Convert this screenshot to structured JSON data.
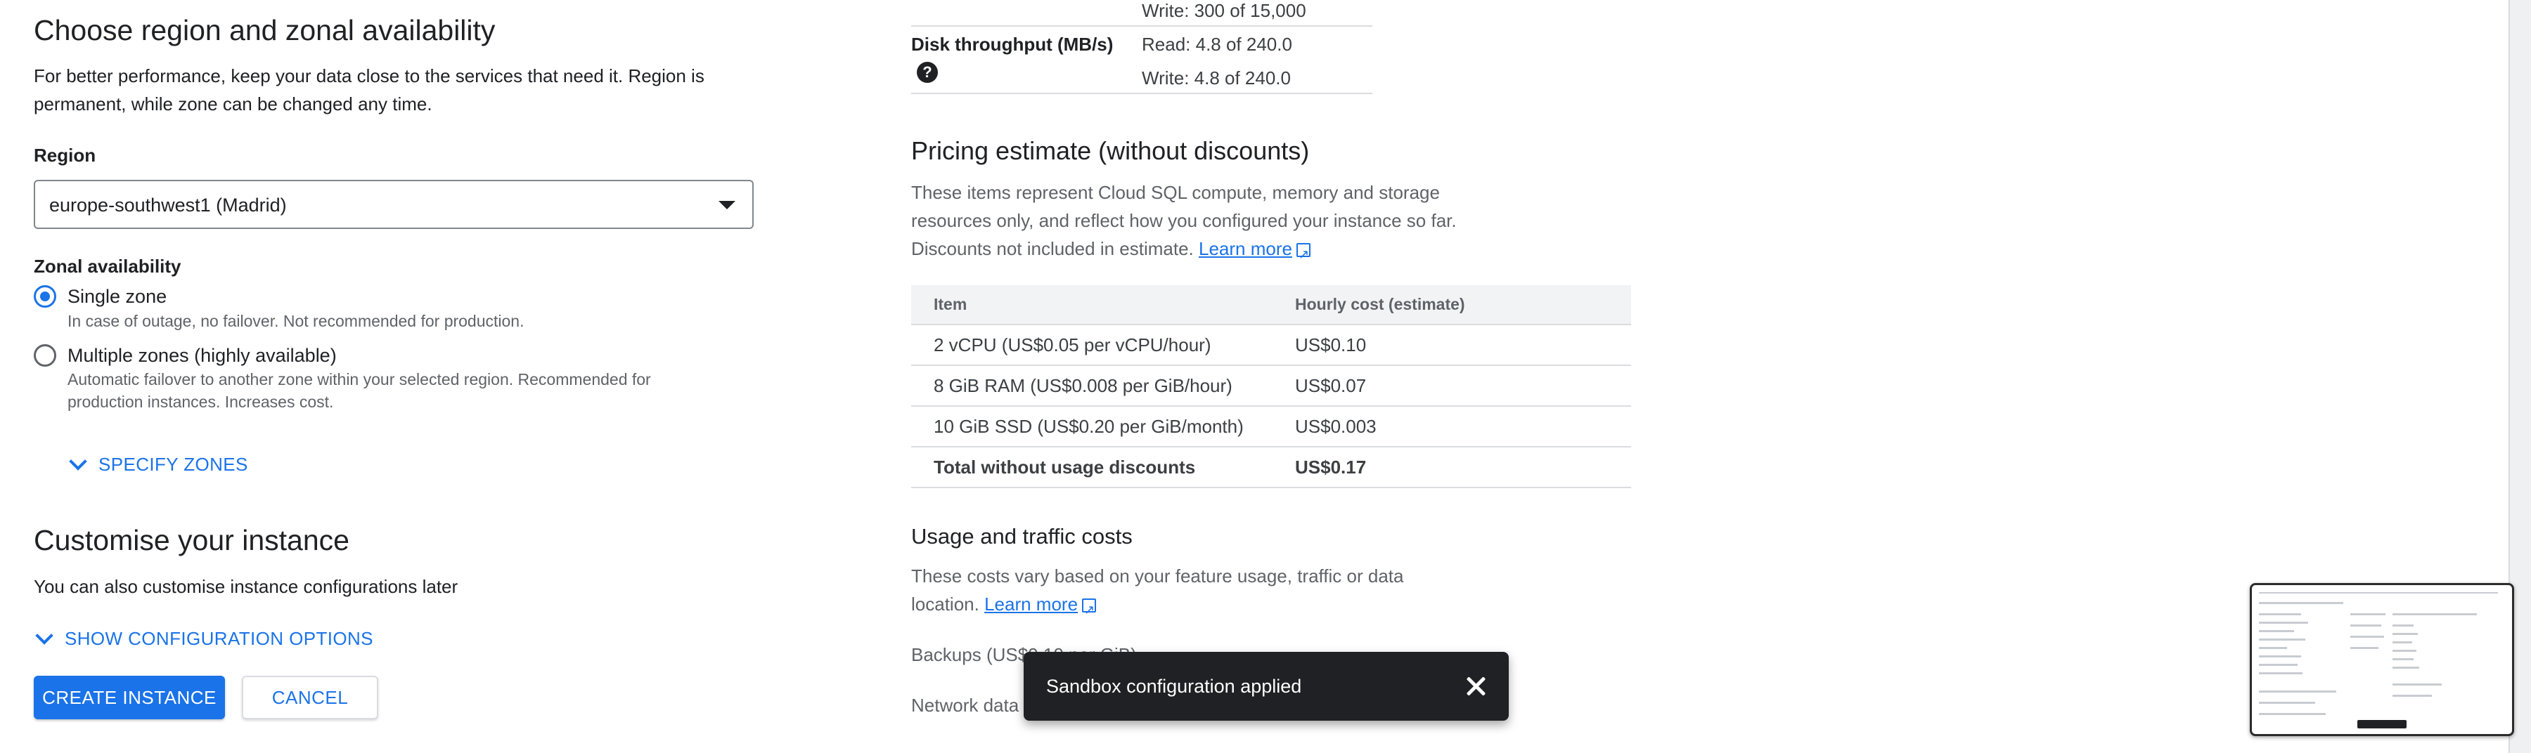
{
  "region_section": {
    "title": "Choose region and zonal availability",
    "description": "For better performance, keep your data close to the services that need it. Region is permanent, while zone can be changed any time.",
    "region_label": "Region",
    "region_value": "europe-southwest1 (Madrid)",
    "zonal_label": "Zonal availability",
    "options": [
      {
        "title": "Single zone",
        "help": "In case of outage, no failover. Not recommended for production.",
        "selected": true
      },
      {
        "title": "Multiple zones (highly available)",
        "help": "Automatic failover to another zone within your selected region. Recommended for production instances. Increases cost.",
        "selected": false
      }
    ],
    "specify_zones_label": "SPECIFY ZONES"
  },
  "customise_section": {
    "title": "Customise your instance",
    "description": "You can also customise instance configurations later",
    "show_options_label": "SHOW CONFIGURATION OPTIONS"
  },
  "actions": {
    "create_label": "CREATE INSTANCE",
    "cancel_label": "CANCEL"
  },
  "performance": {
    "iops_write": "Write: 300 of 15,000",
    "throughput_label": "Disk throughput (MB/s)",
    "throughput_read": "Read: 4.8 of 240.0",
    "throughput_write": "Write: 4.8 of 240.0",
    "help_icon": "help-circle-icon"
  },
  "pricing": {
    "title": "Pricing estimate (without discounts)",
    "description": "These items represent Cloud SQL compute, memory and storage resources only, and reflect how you configured your instance so far. Discounts not included in estimate.",
    "learn_more": "Learn more",
    "columns": [
      "Item",
      "Hourly cost (estimate)"
    ],
    "rows": [
      {
        "item": "2 vCPU (US$0.05 per vCPU/hour)",
        "cost": "US$0.10"
      },
      {
        "item": "8 GiB RAM (US$0.008 per GiB/hour)",
        "cost": "US$0.07"
      },
      {
        "item": "10 GiB SSD (US$0.20 per GiB/month)",
        "cost": "US$0.003"
      }
    ],
    "total": {
      "item": "Total without usage discounts",
      "cost": "US$0.17"
    }
  },
  "usage": {
    "title": "Usage and traffic costs",
    "description": "These costs vary based on your feature usage, traffic or data location.",
    "learn_more": "Learn more",
    "backups": "Backups (US$0.10 per GiB)",
    "network": "Network data"
  },
  "snackbar": {
    "message": "Sandbox configuration applied",
    "close_icon": "close-icon"
  },
  "colors": {
    "accent": "#1a73e8",
    "text": "#202124",
    "muted": "#5f6368",
    "snackbar_bg": "#202124"
  }
}
